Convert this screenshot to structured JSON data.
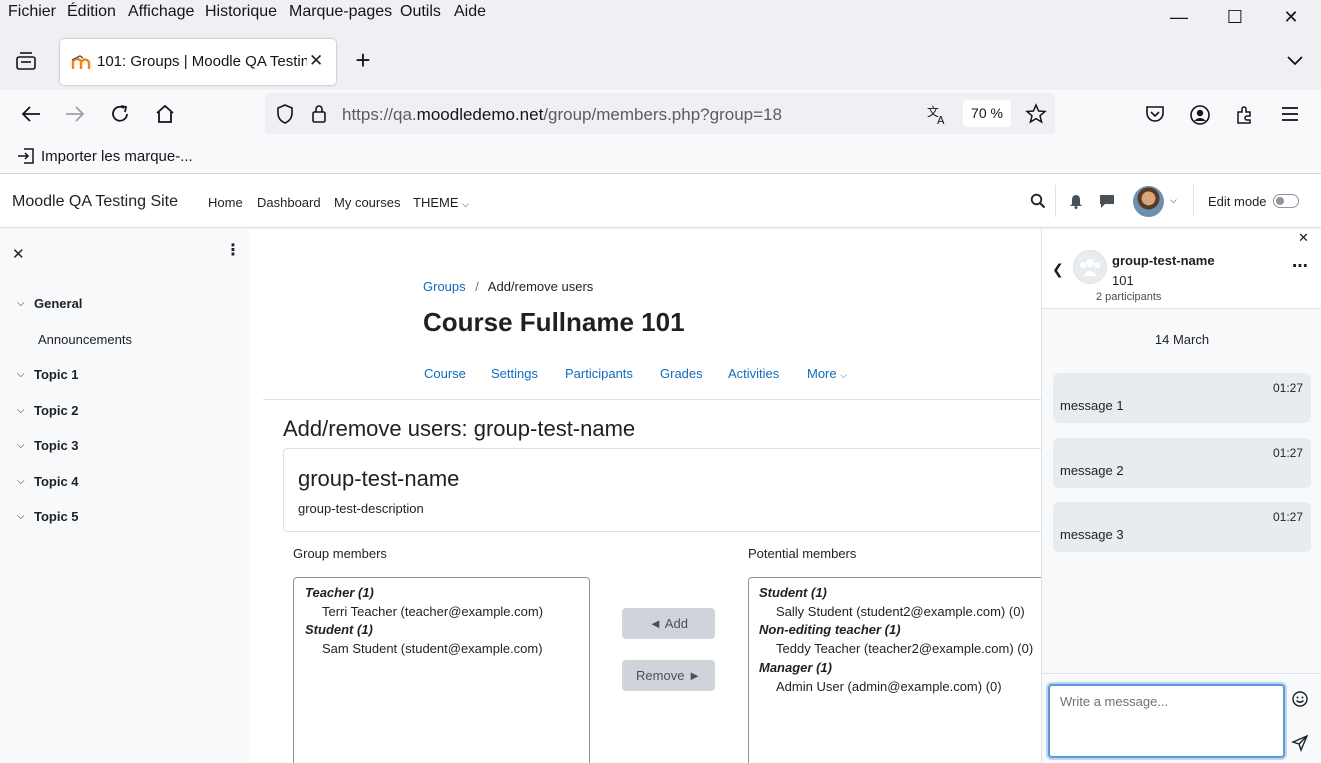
{
  "menubar": {
    "items": [
      "Fichier",
      "Édition",
      "Affichage",
      "Historique",
      "Marque-pages",
      "Outils",
      "Aide"
    ]
  },
  "browser": {
    "tab_title": "101: Groups | Moodle QA Testing Site",
    "url_prefix": "https://qa.",
    "url_domain": "moodledemo.net",
    "url_path": "/group/members.php?group=18",
    "zoom": "70 %",
    "bookmark_import": "Importer les marque-..."
  },
  "moodle_nav": {
    "site_name": "Moodle QA Testing Site",
    "links": [
      "Home",
      "Dashboard",
      "My courses",
      "THEME"
    ],
    "edit_mode_label": "Edit mode"
  },
  "course_index": {
    "sections": [
      {
        "label": "General",
        "items": [
          "Announcements"
        ]
      },
      {
        "label": "Topic 1"
      },
      {
        "label": "Topic 2"
      },
      {
        "label": "Topic 3"
      },
      {
        "label": "Topic 4"
      },
      {
        "label": "Topic 5"
      }
    ]
  },
  "page": {
    "breadcrumb": {
      "link": "Groups",
      "sep": "/",
      "current": "Add/remove users"
    },
    "course_title": "Course Fullname 101",
    "secondary_nav": [
      "Course",
      "Settings",
      "Participants",
      "Grades",
      "Activities",
      "More"
    ],
    "heading": "Add/remove users: group-test-name",
    "group_name": "group-test-name",
    "group_description": "group-test-description",
    "members_label": "Group members",
    "potential_label": "Potential members",
    "members": [
      {
        "role": "Teacher (1)",
        "users": [
          "Terri Teacher (teacher@example.com)"
        ]
      },
      {
        "role": "Student (1)",
        "users": [
          "Sam Student (student@example.com)"
        ]
      }
    ],
    "potential": [
      {
        "role": "Student (1)",
        "users": [
          "Sally Student (student2@example.com) (0)"
        ]
      },
      {
        "role": "Non-editing teacher (1)",
        "users": [
          "Teddy Teacher (teacher2@example.com) (0)"
        ]
      },
      {
        "role": "Manager (1)",
        "users": [
          "Admin User (admin@example.com) (0)"
        ]
      }
    ],
    "add_button": "◄ Add",
    "remove_button": "Remove ►"
  },
  "messaging": {
    "conversation_name": "group-test-name",
    "conversation_sub": "101",
    "participants": "2 participants",
    "date": "14 March",
    "messages": [
      {
        "time": "01:27",
        "text": "message 1"
      },
      {
        "time": "01:27",
        "text": "message 2"
      },
      {
        "time": "01:27",
        "text": "message 3"
      }
    ],
    "input_placeholder": "Write a message..."
  }
}
